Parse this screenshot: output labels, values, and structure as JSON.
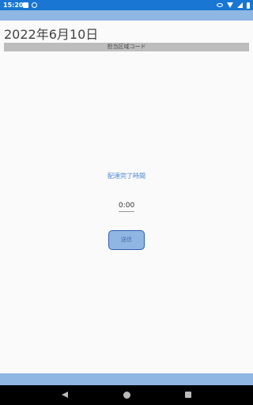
{
  "status_bar": {
    "time": "15:20"
  },
  "header": {
    "date": "2022年6月10日",
    "area_code_label": "担当区域コード"
  },
  "main": {
    "delivery_label": "配達完了時間",
    "time_value": "0:00",
    "send_button_label": "送信"
  },
  "colors": {
    "accent": "#90b6e3",
    "status_bar": "#1976d2",
    "label": "#4a86d8"
  }
}
